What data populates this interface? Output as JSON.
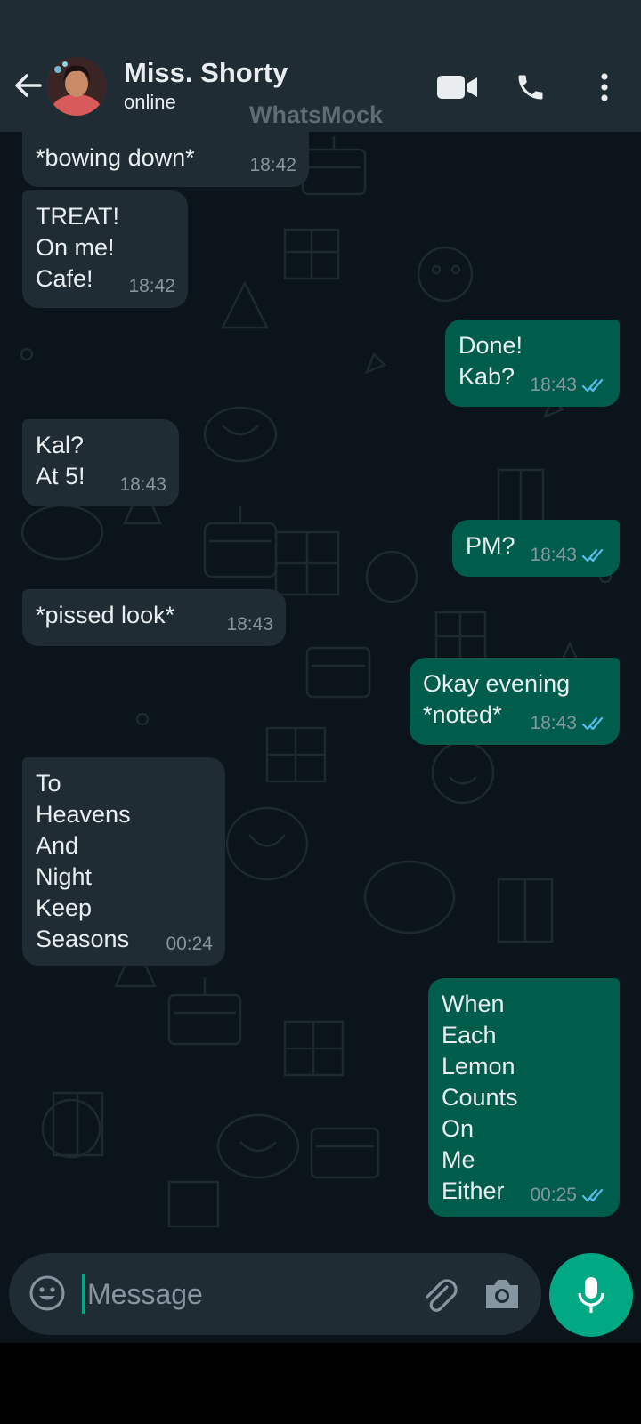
{
  "header": {
    "contact_name": "Miss. Shorty",
    "status": "online",
    "watermark": "WhatsMock"
  },
  "messages": [
    {
      "direction": "in",
      "text": "*bowing down*",
      "time": "18:42"
    },
    {
      "direction": "in",
      "text": "TREAT!\nOn me!\nCafe!",
      "time": "18:42"
    },
    {
      "direction": "out",
      "text": "Done!\nKab?",
      "time": "18:43",
      "status": "read"
    },
    {
      "direction": "in",
      "text": "Kal?\nAt 5!",
      "time": "18:43"
    },
    {
      "direction": "out",
      "text": "PM?",
      "time": "18:43",
      "status": "read"
    },
    {
      "direction": "in",
      "text": "*pissed look*",
      "time": "18:43"
    },
    {
      "direction": "out",
      "text": "Okay evening\n*noted*",
      "time": "18:43",
      "status": "read"
    },
    {
      "direction": "in",
      "text": "To\nHeavens\nAnd\nNight\nKeep\nSeasons",
      "time": "00:24"
    },
    {
      "direction": "out",
      "text": "When\nEach\nLemon\nCounts\nOn\nMe\nEither",
      "time": "00:25",
      "status": "read"
    }
  ],
  "input": {
    "placeholder": "Message"
  },
  "icons": {
    "back": "arrow-left-icon",
    "video": "video-camera-icon",
    "call": "phone-icon",
    "more": "more-vertical-icon",
    "emoji": "emoji-icon",
    "attach": "paperclip-icon",
    "camera": "camera-icon",
    "mic": "microphone-icon"
  },
  "colors": {
    "background": "#0b141a",
    "header": "#1f2c34",
    "incoming_bubble": "#1f2c34",
    "outgoing_bubble": "#005c4b",
    "accent": "#00a884",
    "read_ticks": "#53bdeb",
    "timestamp": "#8696a0"
  }
}
